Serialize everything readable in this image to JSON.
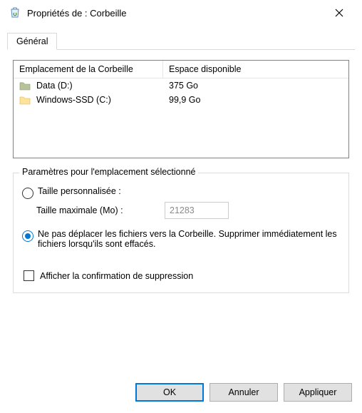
{
  "window": {
    "title": "Propriétés de : Corbeille",
    "icon": "recycle-bin-icon"
  },
  "tabs": [
    {
      "label": "Général"
    }
  ],
  "table": {
    "headers": {
      "location": "Emplacement de la Corbeille",
      "space": "Espace disponible"
    },
    "rows": [
      {
        "name": "Data (D:)",
        "space": "375 Go",
        "folder_tint": "#9aa77a"
      },
      {
        "name": "Windows-SSD (C:)",
        "space": "99,9 Go",
        "folder_tint": "#f0c756"
      }
    ]
  },
  "settings": {
    "legend": "Paramètres pour l'emplacement sélectionné",
    "custom_size_label": "Taille personnalisée :",
    "max_size_label": "Taille maximale (Mo) :",
    "max_size_value": "21283",
    "no_move_label": "Ne pas déplacer les fichiers vers la Corbeille. Supprimer immédiatement les fichiers lorsqu'ils sont effacés.",
    "selected_option": "no_move",
    "confirm_delete_label": "Afficher la confirmation de suppression",
    "confirm_delete_checked": false
  },
  "buttons": {
    "ok": "OK",
    "cancel": "Annuler",
    "apply": "Appliquer"
  }
}
